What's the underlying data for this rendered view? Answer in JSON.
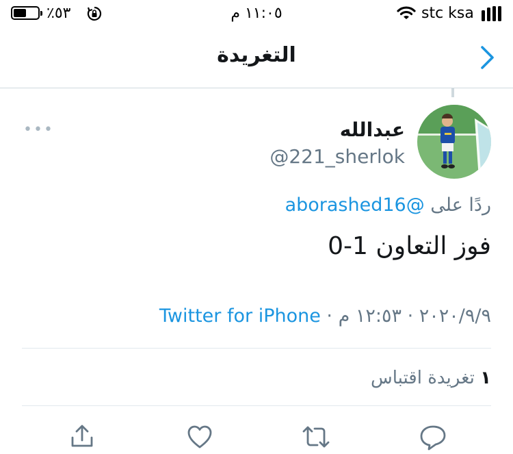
{
  "status_bar": {
    "battery_text": "٪٥٣",
    "time": "١١:٠٥ م",
    "carrier": "stc ksa",
    "battery_level": 0.53
  },
  "nav": {
    "title": "التغريدة",
    "back_icon": "chevron-right-icon"
  },
  "tweet": {
    "display_name": "عبدالله",
    "handle": "@221_sherlok",
    "reply_prefix": "ردًا على",
    "reply_mention": "@aborashed16",
    "text": "فوز التعاون 1-0",
    "date": "٢٠٢٠/٩/٩",
    "time": "١٢:٥٣ م",
    "source": "Twitter for iPhone",
    "quote_count": "١",
    "quote_label": "تغريدة اقتباس",
    "more_label": "•••"
  },
  "actions": [
    {
      "icon": "share-icon"
    },
    {
      "icon": "heart-icon"
    },
    {
      "icon": "retweet-icon"
    },
    {
      "icon": "reply-icon"
    }
  ],
  "colors": {
    "accent": "#1b95e0",
    "secondary_text": "#657786",
    "divider": "#e1e8ed"
  }
}
